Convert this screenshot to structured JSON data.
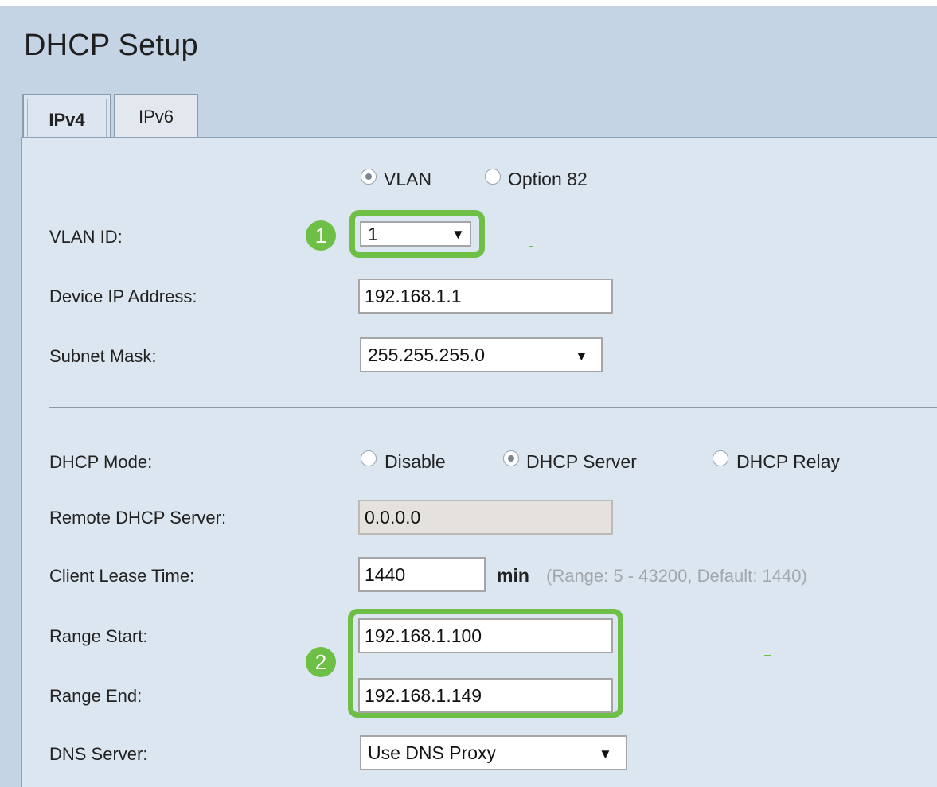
{
  "page": {
    "title": "DHCP Setup"
  },
  "tabs": [
    {
      "label": "IPv4",
      "active": true
    },
    {
      "label": "IPv6",
      "active": false
    }
  ],
  "mode_radios": [
    {
      "label": "VLAN",
      "checked": true
    },
    {
      "label": "Option 82",
      "checked": false
    }
  ],
  "fields": {
    "vlan_id": {
      "label": "VLAN ID:",
      "value": "1",
      "arrow": "▼"
    },
    "device_ip": {
      "label": "Device IP Address:",
      "value": "192.168.1.1"
    },
    "subnet_mask": {
      "label": "Subnet Mask:",
      "value": "255.255.255.0",
      "arrow": "▼"
    },
    "dhcp_mode": {
      "label": "DHCP Mode:",
      "options": [
        {
          "label": "Disable",
          "checked": false
        },
        {
          "label": "DHCP Server",
          "checked": true
        },
        {
          "label": "DHCP Relay",
          "checked": false
        }
      ]
    },
    "remote_dhcp_server": {
      "label": "Remote DHCP Server:",
      "value": "0.0.0.0",
      "disabled": true
    },
    "client_lease_time": {
      "label": "Client Lease Time:",
      "value": "1440",
      "unit": "min",
      "hint": "(Range: 5 - 43200, Default: 1440)"
    },
    "range_start": {
      "label": "Range Start:",
      "value": "192.168.1.100"
    },
    "range_end": {
      "label": "Range End:",
      "value": "192.168.1.149"
    },
    "dns_server": {
      "label": "DNS Server:",
      "value": "Use DNS Proxy",
      "arrow": "▼"
    }
  },
  "annotations": [
    {
      "number": "1"
    },
    {
      "number": "2"
    }
  ],
  "colors": {
    "highlight": "#6dbf45",
    "page_background": "#c5d4e4",
    "panel_background": "#dce6f1"
  }
}
